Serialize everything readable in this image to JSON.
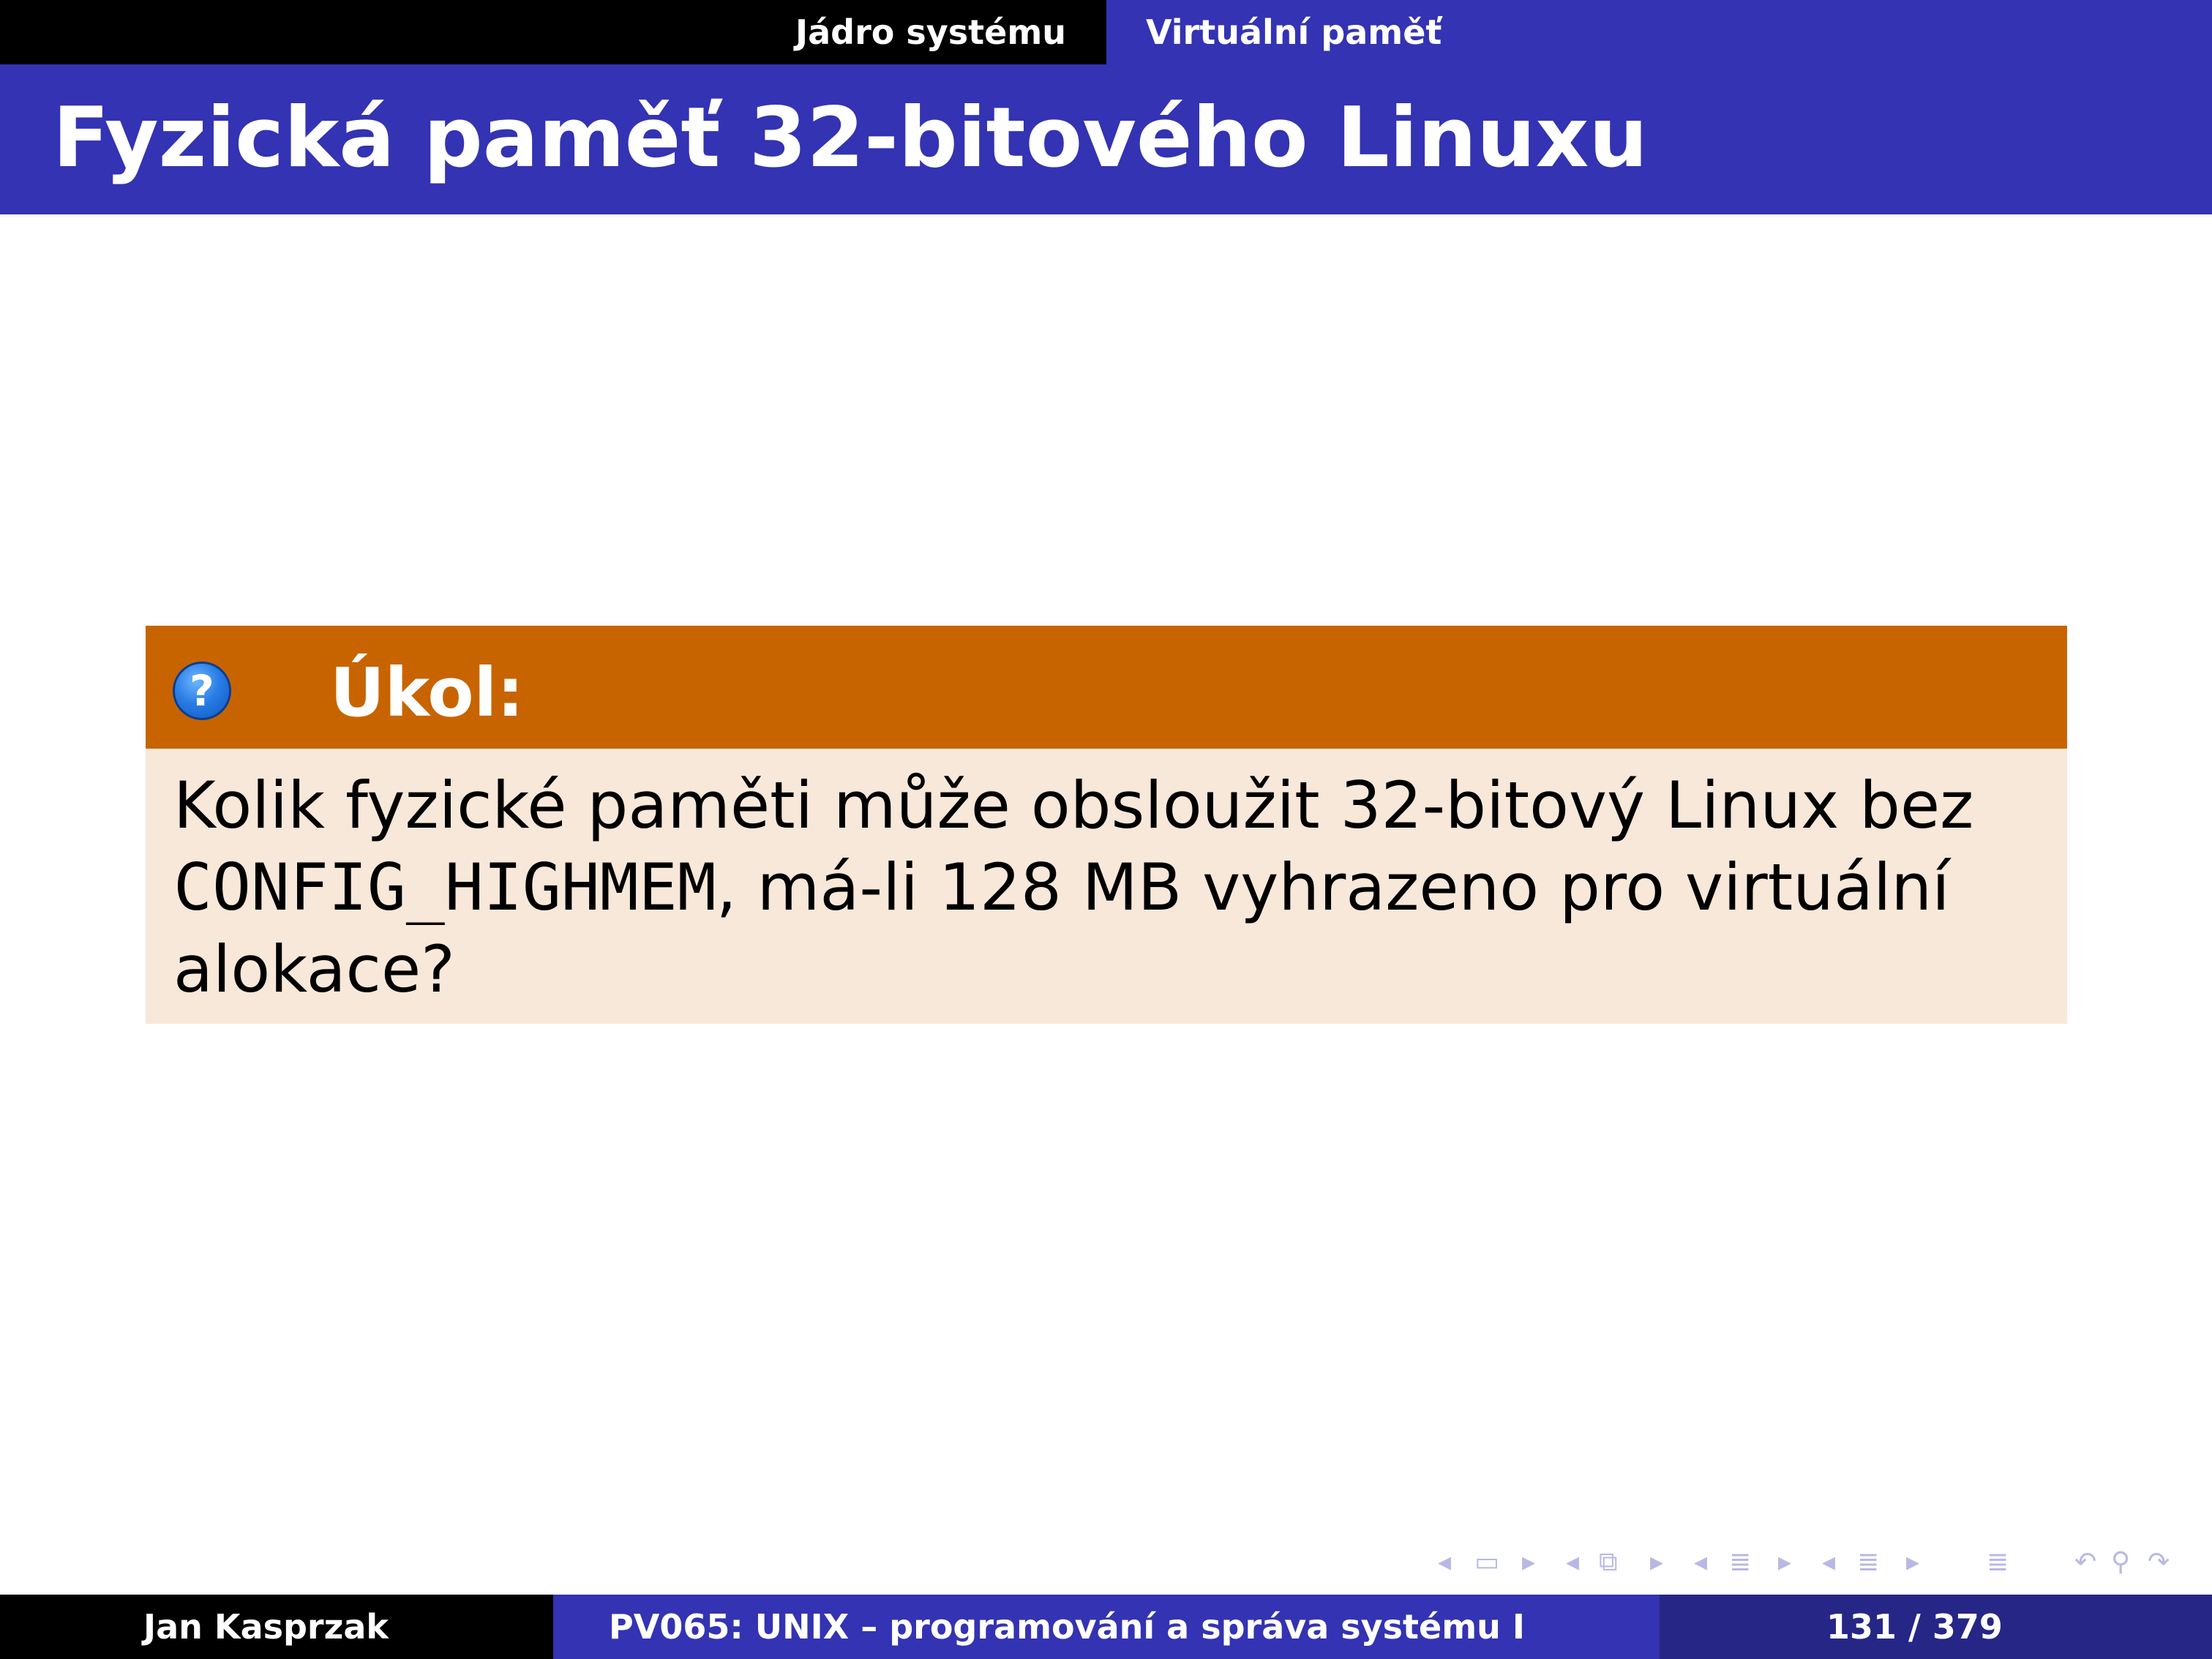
{
  "header": {
    "section": "Jádro systému",
    "subsection": "Virtuální paměť"
  },
  "frame": {
    "title": "Fyzická paměť 32-bitového Linuxu"
  },
  "block": {
    "icon": "question-icon",
    "title": "Úkol:",
    "text_before": "Kolik fyzické paměti může obsloužit 32-bitový Linux bez ",
    "code": "CONFIG_HIGHMEM",
    "text_after": ", má-li 128 MB vyhrazeno pro virtuální alokace?"
  },
  "navigation": {
    "icons": [
      "arrow-left-icon",
      "frame-icon",
      "arrow-right-icon",
      "arrow-left-icon",
      "subsection-icon",
      "arrow-right-icon",
      "arrow-left-icon",
      "section-icon",
      "arrow-right-icon",
      "arrow-left-icon",
      "document-icon",
      "arrow-right-icon",
      "align-icon",
      "undo-icon",
      "search-icon",
      "redo-icon"
    ]
  },
  "footer": {
    "author": "Jan Kasprzak",
    "course": "PV065: UNIX – programování a správa systému I",
    "page": "131 / 379"
  },
  "colors": {
    "structure": "#3333b3",
    "block_title_bg": "#c86400",
    "block_body_bg": "#f8e8da",
    "footer_page_bg": "#262686"
  }
}
